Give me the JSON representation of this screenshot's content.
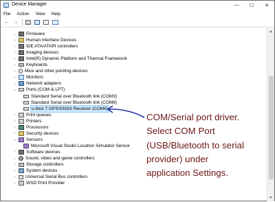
{
  "window": {
    "title": "Device Manager",
    "controls": {
      "minimize": "—",
      "maximize": "☐",
      "close": "✕"
    }
  },
  "menu": [
    "File",
    "Action",
    "View",
    "Help"
  ],
  "toolbar": {
    "icons": [
      "back-arrow-icon",
      "forward-arrow-icon",
      "properties-icon",
      "help-icon",
      "details-view-icon",
      "monitor-icon"
    ],
    "back": "←",
    "forward": "→"
  },
  "tree": {
    "items": [
      {
        "label": "Firmware",
        "expanded": false,
        "icon": "chip-icon",
        "level": 0
      },
      {
        "label": "Human Interface Devices",
        "expanded": false,
        "icon": "hid-icon",
        "level": 0
      },
      {
        "label": "IDE ATA/ATAPI controllers",
        "expanded": false,
        "icon": "ide-controller-icon",
        "level": 0
      },
      {
        "label": "Imaging devices",
        "expanded": false,
        "icon": "camera-icon",
        "level": 0
      },
      {
        "label": "Intel(R) Dynamic Platform and Thermal Framework",
        "expanded": false,
        "icon": "thermal-icon",
        "level": 0
      },
      {
        "label": "Keyboards",
        "expanded": false,
        "icon": "keyboard-icon",
        "level": 0
      },
      {
        "label": "Mice and other pointing devices",
        "expanded": false,
        "icon": "mouse-icon",
        "level": 0
      },
      {
        "label": "Monitors",
        "expanded": false,
        "icon": "monitor-icon",
        "level": 0
      },
      {
        "label": "Network adapters",
        "expanded": false,
        "icon": "network-icon",
        "level": 0
      },
      {
        "label": "Ports (COM & LPT)",
        "expanded": true,
        "icon": "port-icon",
        "level": 0
      },
      {
        "label": "Standard Serial over Bluetooth link (COM3)",
        "icon": "port-icon",
        "level": 1
      },
      {
        "label": "Standard Serial over Bluetooth link (COM8)",
        "icon": "port-icon",
        "level": 1
      },
      {
        "label": "u-blox 7 GPS/GNSS Receiver (COM6)",
        "icon": "port-icon",
        "level": 1,
        "selected": true
      },
      {
        "label": "Print queues",
        "expanded": false,
        "icon": "printer-icon",
        "level": 0
      },
      {
        "label": "Printers",
        "expanded": false,
        "icon": "printer-icon",
        "level": 0
      },
      {
        "label": "Processors",
        "expanded": false,
        "icon": "cpu-icon",
        "level": 0
      },
      {
        "label": "Security devices",
        "expanded": false,
        "icon": "security-icon",
        "level": 0
      },
      {
        "label": "Sensors",
        "expanded": true,
        "icon": "sensor-icon",
        "level": 0
      },
      {
        "label": "Microsoft Visual Studio Location Simulator Sensor",
        "icon": "sensor-icon",
        "level": 1
      },
      {
        "label": "Software devices",
        "expanded": false,
        "icon": "software-icon",
        "level": 0
      },
      {
        "label": "Sound, video and game controllers",
        "expanded": false,
        "icon": "sound-icon",
        "level": 0
      },
      {
        "label": "Storage controllers",
        "expanded": false,
        "icon": "storage-icon",
        "level": 0
      },
      {
        "label": "System devices",
        "expanded": false,
        "icon": "system-icon",
        "level": 0
      },
      {
        "label": "Universal Serial Bus controllers",
        "expanded": false,
        "icon": "usb-icon",
        "level": 0
      },
      {
        "label": "WSD Print Provider",
        "expanded": false,
        "icon": "printer-icon",
        "level": 0
      }
    ]
  },
  "annotation": {
    "lines": [
      "COM/Serial port driver.",
      "Select COM Port",
      "(USB/Bluetooth to serial",
      "provider) under",
      "application Settings."
    ],
    "color": "#6b1515",
    "arrow_color": "#1f2fa8"
  },
  "colors": {
    "selection": "#cce8ff",
    "scroll_thumb": "#cdcdcd"
  }
}
